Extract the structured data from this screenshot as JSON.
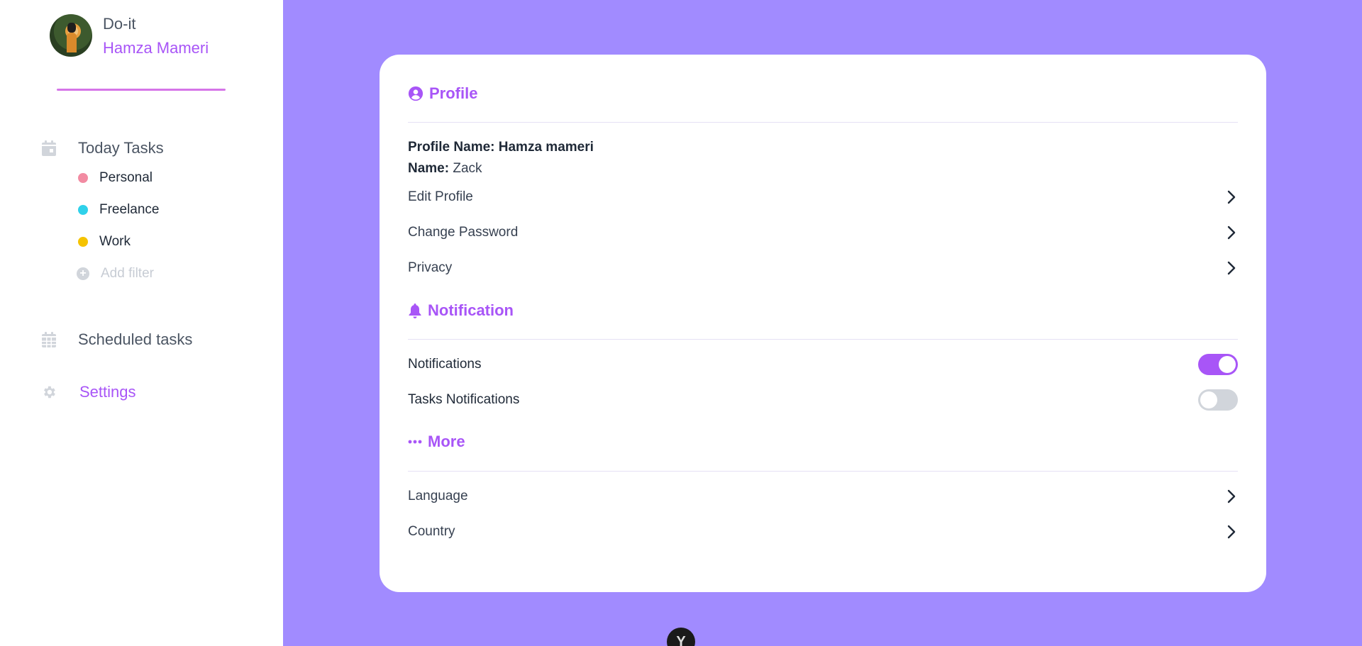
{
  "colors": {
    "accent": "#a855f7",
    "background": "#a18bff",
    "personal": "#f28ba2",
    "freelance": "#2fd1ea",
    "work": "#f5c300"
  },
  "sidebar": {
    "app_title": "Do-it",
    "user_name": "Hamza Mameri",
    "today": {
      "label": "Today Tasks",
      "icon": "calendar-icon"
    },
    "filters": [
      {
        "label": "Personal",
        "color": "#f28ba2"
      },
      {
        "label": "Freelance",
        "color": "#2fd1ea"
      },
      {
        "label": "Work",
        "color": "#f5c300"
      }
    ],
    "add_filter": "Add filter",
    "scheduled": {
      "label": "Scheduled tasks",
      "icon": "calendar-grid-icon"
    },
    "settings": {
      "label": "Settings",
      "icon": "gear-icon"
    }
  },
  "card": {
    "profile": {
      "title": "Profile",
      "profile_name_label": "Profile Name:",
      "profile_name_value": "Hamza mameri",
      "name_label": "Name:",
      "name_value": "Zack",
      "items": [
        "Edit Profile",
        "Change Password",
        "Privacy"
      ]
    },
    "notification": {
      "title": "Notification",
      "items": [
        {
          "label": "Notifications",
          "on": true
        },
        {
          "label": "Tasks Notifications",
          "on": false
        }
      ]
    },
    "more": {
      "title": "More",
      "items": [
        "Language",
        "Country"
      ]
    }
  },
  "fab_label": "Y"
}
